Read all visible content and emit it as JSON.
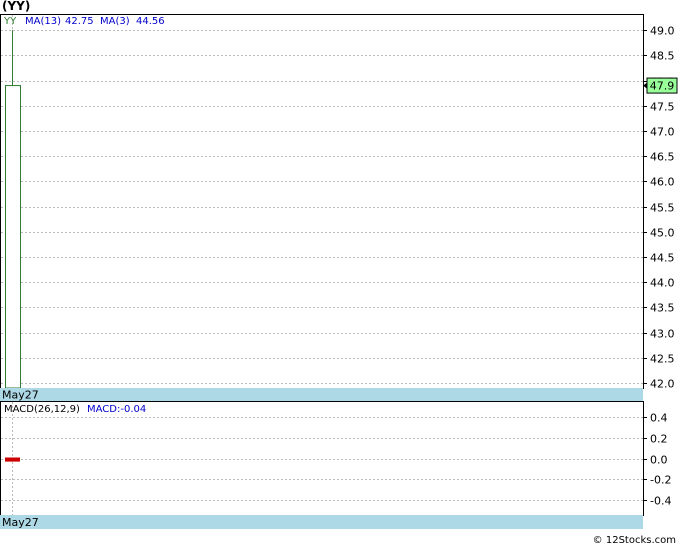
{
  "title": "(YY)",
  "footer": "© 12Stocks.com",
  "colors": {
    "price_line": "#2e7d32",
    "candle_border": "#2e7d32",
    "last_price_bg": "#99ff99",
    "date_band": "#add8e6",
    "grid": "#bbbbbb",
    "legend_blue": "#0000cc",
    "macd_bar": "#cc0000"
  },
  "legend": {
    "symbol": "YY",
    "ma13_label": "MA(13)",
    "ma13_value": "42.75",
    "ma3_label": "MA(3)",
    "ma3_value": "44.56"
  },
  "macd_legend": {
    "label": "MACD(26,12,9)",
    "value": "MACD:-0.04"
  },
  "date_label": "May27",
  "chart_data": [
    {
      "type": "candlestick",
      "panel": "price",
      "ylim": [
        41.9,
        49.3
      ],
      "yticks": [
        "42.0",
        "42.5",
        "43.0",
        "43.5",
        "44.0",
        "44.5",
        "45.0",
        "45.5",
        "46.0",
        "46.5",
        "47.0",
        "47.5",
        "48.0",
        "48.5",
        "49.0"
      ],
      "last_price": "47.9",
      "grid": true,
      "candles": [
        {
          "date": "May27",
          "open": 41.9,
          "close": 47.9,
          "high": 49.0,
          "low": 41.9
        }
      ]
    },
    {
      "type": "bar",
      "panel": "macd",
      "ylim": [
        -0.55,
        0.55
      ],
      "yticks": [
        "0.4",
        "0.2",
        "0.0",
        "-0.2",
        "-0.4"
      ],
      "grid": true,
      "categories": [
        "May27"
      ],
      "values": [
        -0.04
      ]
    }
  ]
}
